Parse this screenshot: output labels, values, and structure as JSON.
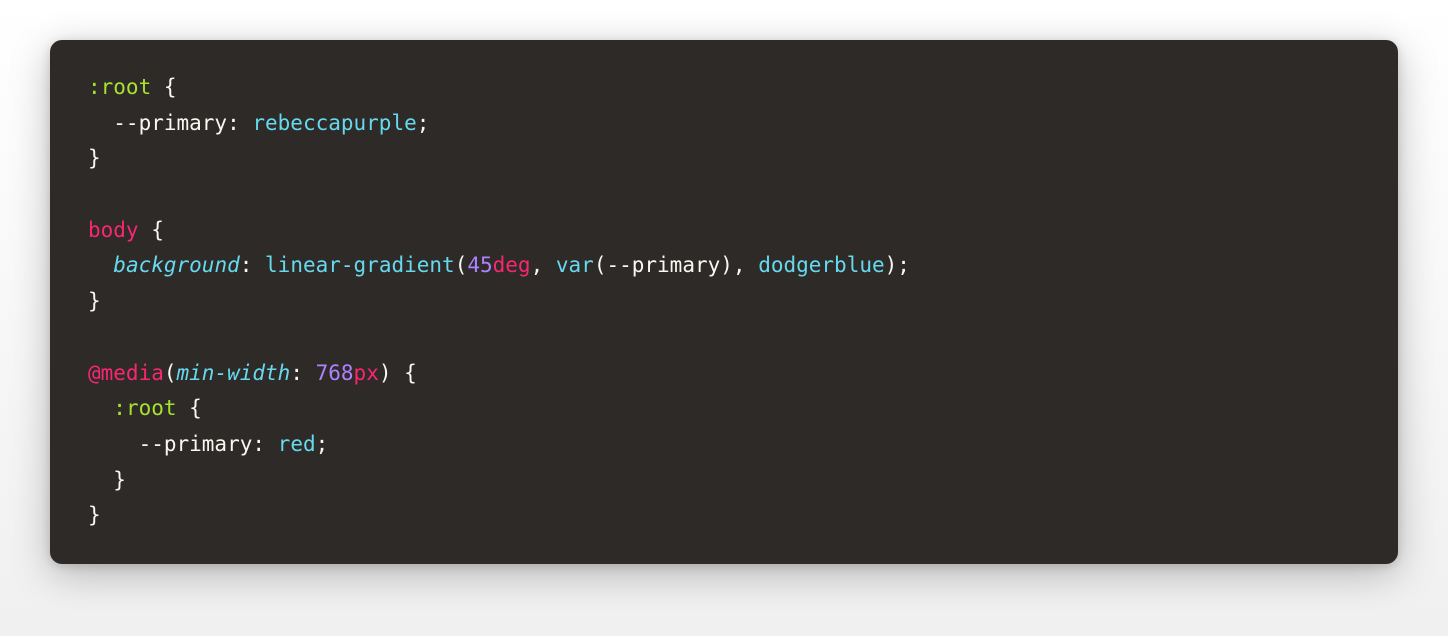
{
  "colors": {
    "selector": "#a6e22e",
    "tagSelector": "#f92672",
    "white": "#f8f8f2",
    "cyan": "#66d9ef",
    "cyanItalic": "#66d9ef",
    "magenta": "#f92672",
    "purple": "#ae81ff"
  },
  "tokens": [
    [
      {
        "text": ":root",
        "color": "selector"
      },
      {
        "text": " {",
        "color": "white"
      }
    ],
    [
      {
        "text": "  --primary",
        "color": "white"
      },
      {
        "text": ": ",
        "color": "white"
      },
      {
        "text": "rebeccapurple",
        "color": "cyan"
      },
      {
        "text": ";",
        "color": "white"
      }
    ],
    [
      {
        "text": "}",
        "color": "white"
      }
    ],
    [],
    [
      {
        "text": "body",
        "color": "tagSelector"
      },
      {
        "text": " {",
        "color": "white"
      }
    ],
    [
      {
        "text": "  ",
        "color": "white"
      },
      {
        "text": "background",
        "color": "cyanItalic",
        "italic": true
      },
      {
        "text": ": ",
        "color": "white"
      },
      {
        "text": "linear-gradient",
        "color": "cyan"
      },
      {
        "text": "(",
        "color": "white"
      },
      {
        "text": "45",
        "color": "purple"
      },
      {
        "text": "deg",
        "color": "magenta"
      },
      {
        "text": ", ",
        "color": "white"
      },
      {
        "text": "var",
        "color": "cyan"
      },
      {
        "text": "(",
        "color": "white"
      },
      {
        "text": "--primary",
        "color": "white"
      },
      {
        "text": "), ",
        "color": "white"
      },
      {
        "text": "dodgerblue",
        "color": "cyan"
      },
      {
        "text": ");",
        "color": "white"
      }
    ],
    [
      {
        "text": "}",
        "color": "white"
      }
    ],
    [],
    [
      {
        "text": "@media",
        "color": "magenta"
      },
      {
        "text": "(",
        "color": "white"
      },
      {
        "text": "min-width",
        "color": "cyanItalic",
        "italic": true
      },
      {
        "text": ": ",
        "color": "white"
      },
      {
        "text": "768",
        "color": "purple"
      },
      {
        "text": "px",
        "color": "magenta"
      },
      {
        "text": ") {",
        "color": "white"
      }
    ],
    [
      {
        "text": "  ",
        "color": "white"
      },
      {
        "text": ":root",
        "color": "selector"
      },
      {
        "text": " {",
        "color": "white"
      }
    ],
    [
      {
        "text": "    --primary",
        "color": "white"
      },
      {
        "text": ": ",
        "color": "white"
      },
      {
        "text": "red",
        "color": "cyan"
      },
      {
        "text": ";",
        "color": "white"
      }
    ],
    [
      {
        "text": "  }",
        "color": "white"
      }
    ],
    [
      {
        "text": "}",
        "color": "white"
      }
    ]
  ]
}
